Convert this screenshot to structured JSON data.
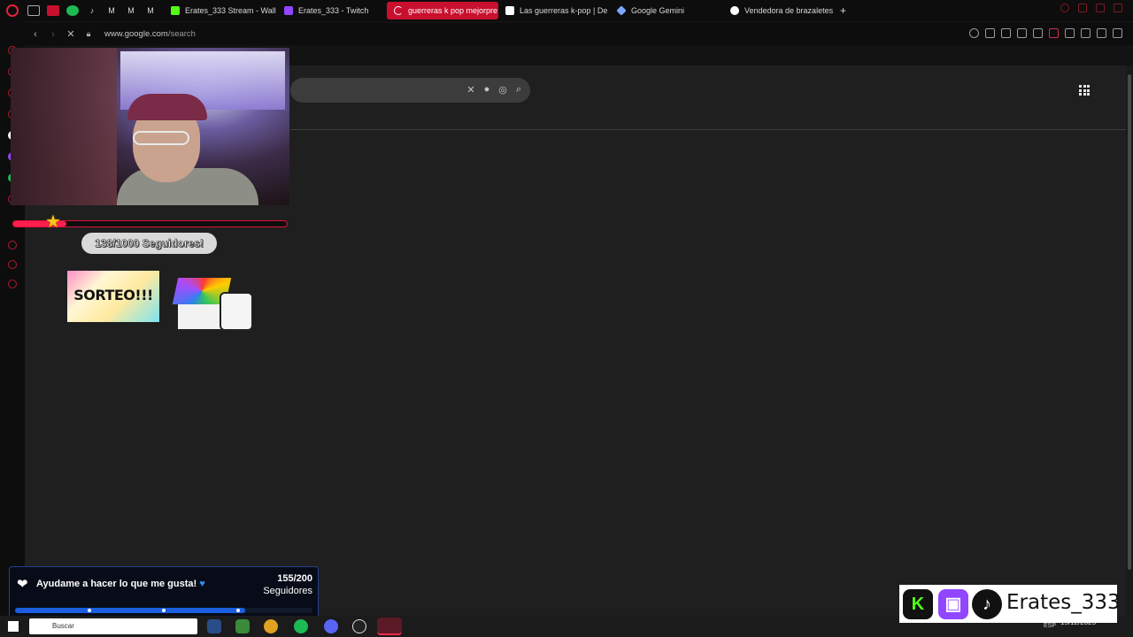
{
  "browser": {
    "tabs": [
      {
        "label": "Erates_333 Stream - Wall",
        "icon_color": "#53fc18",
        "active": false
      },
      {
        "label": "Erates_333 - Twitch",
        "icon_color": "#9146ff",
        "active": false
      },
      {
        "label": "guerreras k pop mejorpre",
        "icon_color": "#ffffff",
        "active": true
      },
      {
        "label": "Las guerreras k-pop | De",
        "icon_color": "#ffffff",
        "active": false
      },
      {
        "label": "Google Gemini",
        "icon_color": "#7aa8ff",
        "active": false
      },
      {
        "label": "Vendedora de brazaletes",
        "icon_color": "#ffffff",
        "active": false
      }
    ],
    "new_tab": "+",
    "address": {
      "host": "www.google.com",
      "path": "/search"
    }
  },
  "stream_overlay": {
    "follower_goal": {
      "label": "138/1000 Seguidores!",
      "current": 138,
      "target": 1000
    },
    "giveaway": {
      "banner": "SORTEO!!!",
      "prize_icon": "console-icon"
    },
    "support_goal": {
      "message": "Ayudame a hacer lo que me gusta!",
      "count": "155/200",
      "unit": "Seguidores",
      "current": 155,
      "target": 200
    },
    "socials": {
      "handle": "Erates_333",
      "icons": [
        "kick-icon",
        "twitch-icon",
        "tiktok-icon"
      ]
    }
  },
  "taskbar": {
    "search_placeholder": "Buscar",
    "language": "ESP",
    "date": "15/12/2025"
  },
  "colors": {
    "accent": "#e0103a",
    "support_blue": "#1b5ee0"
  }
}
